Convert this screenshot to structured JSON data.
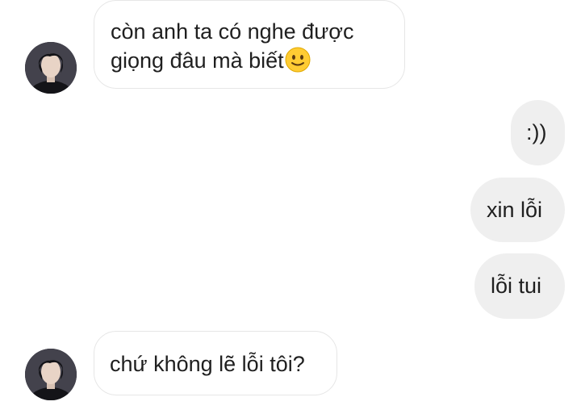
{
  "conversation": {
    "messages": [
      {
        "from": "other",
        "lines": [
          "còn anh ta có nghe được",
          "giọng đâu mà biết"
        ],
        "emoji": "slightly-smiling-face-icon"
      },
      {
        "from": "me",
        "text": ":))"
      },
      {
        "from": "me",
        "text": "xin lỗi"
      },
      {
        "from": "me",
        "text": "lỗi tui"
      },
      {
        "from": "other",
        "text": "chứ không lẽ lỗi tôi?"
      }
    ]
  },
  "colors": {
    "outgoing_bubble": "#efefef",
    "incoming_border": "#e6e6e6",
    "text": "#1f1f1f",
    "emoji_face": "#ffcc33"
  }
}
